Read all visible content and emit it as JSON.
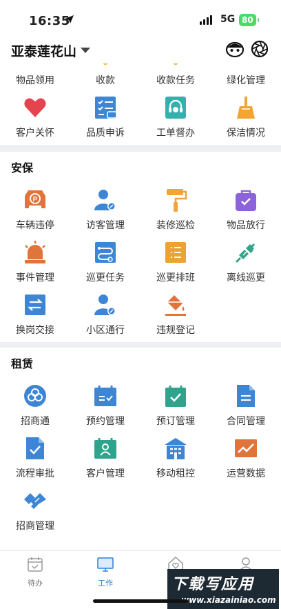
{
  "status_bar": {
    "time": "16:35",
    "network": "5G",
    "battery": "80"
  },
  "header": {
    "title": "亚泰莲花山"
  },
  "colors": {
    "accent": "#2f7fd7",
    "divider": "#eef0f3",
    "battery": "#4cd964"
  },
  "partial_row": [
    "物品领用",
    "收款",
    "收款任务",
    "绿化管理"
  ],
  "row2": [
    {
      "label": "客户关怀",
      "icon": "heart-icon"
    },
    {
      "label": "品质申诉",
      "icon": "checklist-icon"
    },
    {
      "label": "工单督办",
      "icon": "headset-icon"
    },
    {
      "label": "保洁情况",
      "icon": "broom-icon"
    }
  ],
  "section_security": {
    "title": "安保",
    "items": [
      {
        "label": "车辆违停",
        "icon": "parking-car-icon"
      },
      {
        "label": "访客管理",
        "icon": "visitor-icon"
      },
      {
        "label": "装修巡检",
        "icon": "paint-roller-icon"
      },
      {
        "label": "物品放行",
        "icon": "bag-check-icon"
      },
      {
        "label": "事件管理",
        "icon": "alarm-light-icon"
      },
      {
        "label": "巡更任务",
        "icon": "route-icon"
      },
      {
        "label": "巡更排班",
        "icon": "schedule-list-icon"
      },
      {
        "label": "离线巡更",
        "icon": "plug-icon"
      },
      {
        "label": "换岗交接",
        "icon": "swap-icon"
      },
      {
        "label": "小区通行",
        "icon": "pass-user-icon"
      },
      {
        "label": "违规登记",
        "icon": "paint-bucket-icon"
      }
    ]
  },
  "section_rental": {
    "title": "租赁",
    "items": [
      {
        "label": "招商通",
        "icon": "cloud-icon"
      },
      {
        "label": "预约管理",
        "icon": "calendar-equal-icon"
      },
      {
        "label": "预订管理",
        "icon": "calendar-check-icon"
      },
      {
        "label": "合同管理",
        "icon": "document-icon"
      },
      {
        "label": "流程审批",
        "icon": "doc-check-icon"
      },
      {
        "label": "客户管理",
        "icon": "calendar-person-icon"
      },
      {
        "label": "移动租控",
        "icon": "building-icon"
      },
      {
        "label": "运营数据",
        "icon": "chart-line-icon"
      },
      {
        "label": "招商管理",
        "icon": "handshake-icon"
      }
    ]
  },
  "tabbar": [
    {
      "label": "待办",
      "active": false
    },
    {
      "label": "工作",
      "active": true
    },
    {
      "label": "",
      "active": false
    },
    {
      "label": "",
      "active": false
    }
  ],
  "watermark": {
    "line1": "下载写应用",
    "line2": "www.xiazainiao.com"
  }
}
